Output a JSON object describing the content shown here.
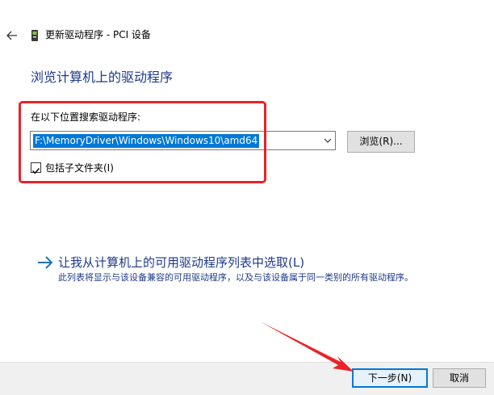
{
  "window": {
    "title": "更新驱动程序 - PCI 设备",
    "back_icon": "back-arrow-icon",
    "driver_icon": "driver-device-icon"
  },
  "main": {
    "heading": "浏览计算机上的驱动程序",
    "search_label": "在以下位置搜索驱动程序:",
    "path_value": "F:\\MemoryDriver\\Windows\\Windows10\\amd64",
    "browse_label": "浏览(R)...",
    "include_subfolders_label": "包括子文件夹(I)",
    "include_subfolders_checked": true,
    "pick_link": "让我从计算机上的可用驱动程序列表中选取(L)",
    "pick_description": "此列表将显示与该设备兼容的可用驱动程序，以及与该设备属于同一类别的所有驱动程序。"
  },
  "footer": {
    "next_label": "下一步(N)",
    "cancel_label": "取消"
  },
  "colors": {
    "accent": "#0078d7",
    "link": "#1e3a8c",
    "annotation_red": "#e8232a",
    "footer_bg": "#f0f0f0"
  }
}
